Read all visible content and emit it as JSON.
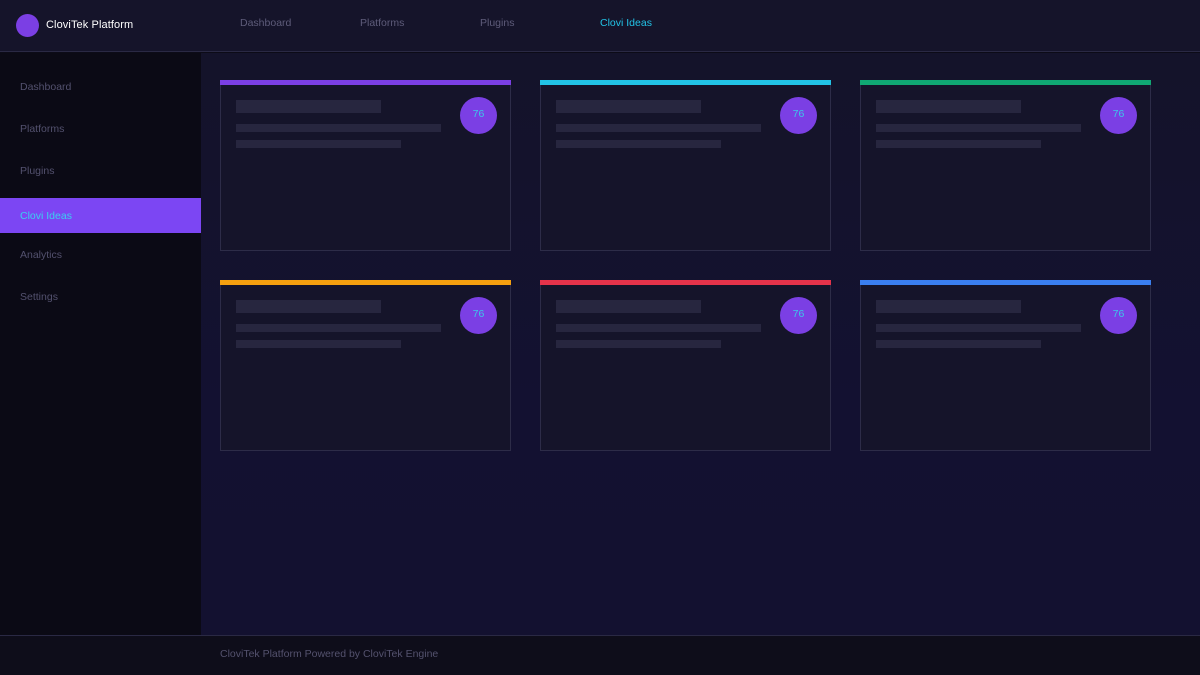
{
  "brand": {
    "name": "CloviTek Platform",
    "logo_color": "#7b3fe4"
  },
  "top_nav": {
    "items": [
      {
        "label": "Dashboard",
        "active": false
      },
      {
        "label": "Platforms",
        "active": false
      },
      {
        "label": "Plugins",
        "active": false
      },
      {
        "label": "Clovi Ideas",
        "active": true
      }
    ]
  },
  "sidebar": {
    "items": [
      {
        "label": "Dashboard",
        "active": false
      },
      {
        "label": "Platforms",
        "active": false
      },
      {
        "label": "Plugins",
        "active": false
      },
      {
        "label": "Clovi Ideas",
        "active": true
      },
      {
        "label": "Analytics",
        "active": false
      },
      {
        "label": "Settings",
        "active": false
      }
    ]
  },
  "cards": [
    {
      "score": "76",
      "accent": "#7b3fe4"
    },
    {
      "score": "76",
      "accent": "#22c3e6"
    },
    {
      "score": "76",
      "accent": "#10a873"
    },
    {
      "score": "76",
      "accent": "#f5a00f"
    },
    {
      "score": "76",
      "accent": "#e5334a"
    },
    {
      "score": "76",
      "accent": "#3a7ff0"
    }
  ],
  "footer": {
    "text": "CloviTek Platform  Powered by CloviTek Engine"
  },
  "colors": {
    "accent_primary": "#7b3fe4",
    "accent_active_text": "#22c3e6"
  }
}
